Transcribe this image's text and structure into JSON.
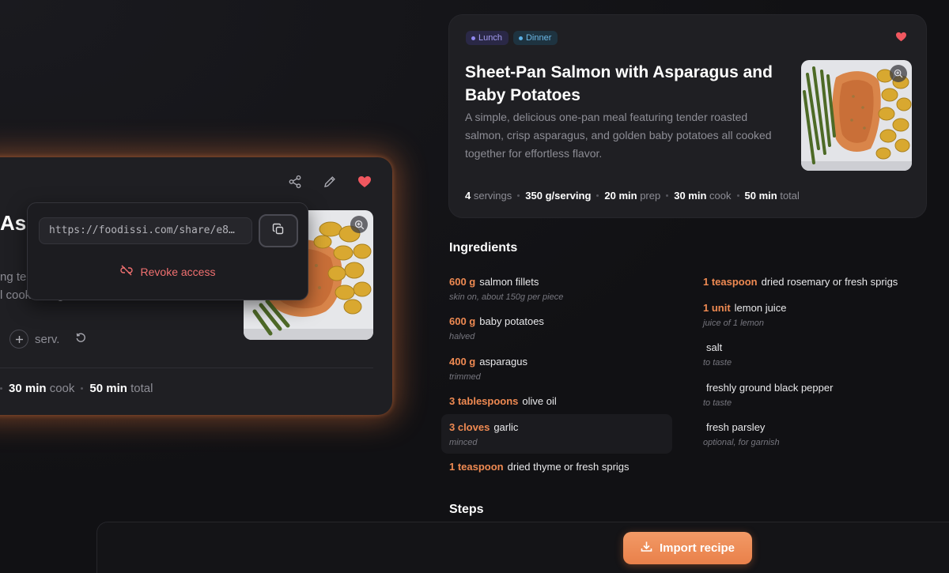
{
  "share_card": {
    "title_fragment": "Asp",
    "desc_fragment_1": "ng te",
    "desc_fragment_2": "l cooked together for effortless flavor.",
    "serv_label": "serv.",
    "meta": {
      "cook_value": "30 min",
      "cook_label": "cook",
      "total_value": "50 min",
      "total_label": "total"
    },
    "icons": [
      "share-icon",
      "edit-icon",
      "heart-icon",
      "zoom-icon",
      "plus-icon",
      "reset-icon"
    ]
  },
  "share_popover": {
    "url": "https://foodissi.com/share/e8…",
    "revoke_label": "Revoke access",
    "icons": [
      "copy-icon",
      "unlink-icon"
    ]
  },
  "recipe": {
    "tags": [
      {
        "label": "Lunch",
        "color": "#8f87f0"
      },
      {
        "label": "Dinner",
        "color": "#5ab0e6"
      }
    ],
    "title": "Sheet-Pan Salmon with Asparagus and Baby Potatoes",
    "description": "A simple, delicious one-pan meal featuring tender roasted salmon, crisp asparagus, and golden baby potatoes all cooked together for effortless flavor.",
    "meta": {
      "servings_value": "4",
      "servings_label": "servings",
      "per_serving_value": "350 g/serving",
      "prep_value": "20 min",
      "prep_label": "prep",
      "cook_value": "30 min",
      "cook_label": "cook",
      "total_value": "50 min",
      "total_label": "total"
    }
  },
  "ingredients": {
    "title": "Ingredients",
    "left": [
      {
        "qty": "600 g",
        "name": "salmon fillets",
        "note": "skin on, about 150g per piece"
      },
      {
        "qty": "600 g",
        "name": "baby potatoes",
        "note": "halved"
      },
      {
        "qty": "400 g",
        "name": "asparagus",
        "note": "trimmed"
      },
      {
        "qty": "3 tablespoons",
        "name": "olive oil",
        "note": ""
      },
      {
        "qty": "3 cloves",
        "name": "garlic",
        "note": "minced"
      },
      {
        "qty": "1 teaspoon",
        "name": "dried thyme or fresh sprigs",
        "note": ""
      }
    ],
    "right": [
      {
        "qty": "1 teaspoon",
        "name": "dried rosemary or fresh sprigs",
        "note": ""
      },
      {
        "qty": "1 unit",
        "name": "lemon juice",
        "note": "juice of 1 lemon"
      },
      {
        "qty": "",
        "name": "salt",
        "note": "to taste"
      },
      {
        "qty": "",
        "name": "freshly ground black pepper",
        "note": "to taste"
      },
      {
        "qty": "",
        "name": "fresh parsley",
        "note": "optional, for garnish"
      }
    ]
  },
  "steps": {
    "title": "Steps"
  },
  "import_button": {
    "label": "Import recipe"
  },
  "colors": {
    "accent": "#ef8a52",
    "heart": "#f0575f",
    "revoke": "#f07070"
  }
}
